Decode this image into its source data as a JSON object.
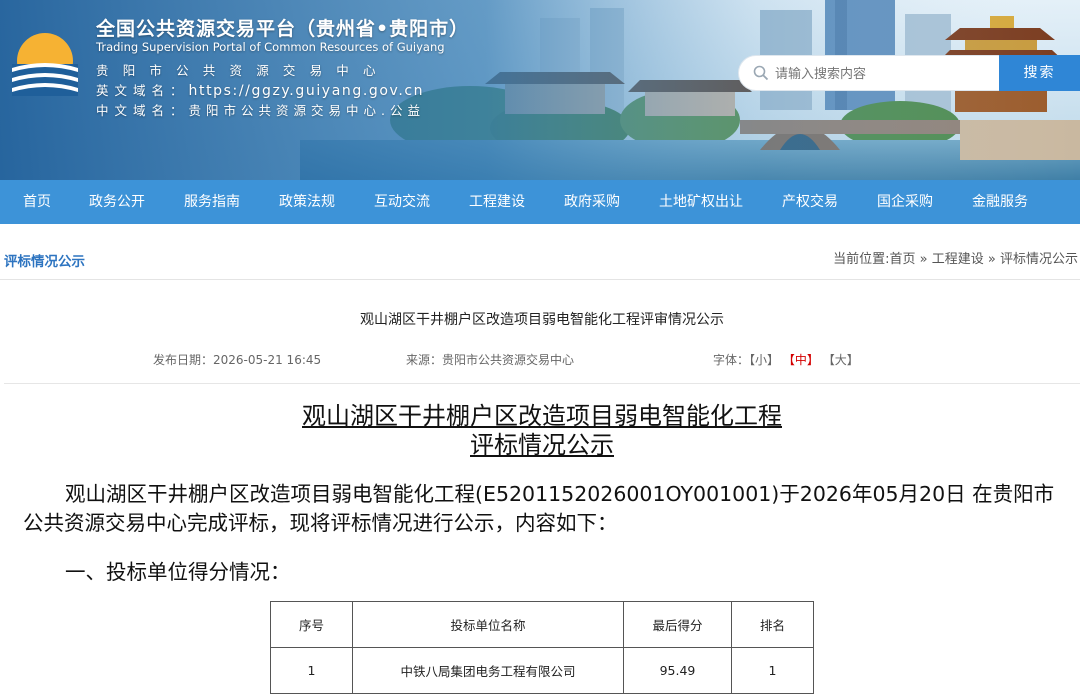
{
  "header": {
    "title": "全国公共资源交易平台（贵州省•贵阳市）",
    "title_en": "Trading Supervision Portal of Common Resources of Guiyang",
    "org_name": "贵阳市公共资源交易中心",
    "en_domain_label": "英文域名：",
    "en_domain": "https://ggzy.guiyang.gov.cn",
    "cn_domain_label": "中文域名：",
    "cn_domain": "贵阳市公共资源交易中心.公益",
    "search_placeholder": "请输入搜索内容",
    "search_button": "搜索",
    "colors": {
      "nav": "#3d93d8",
      "search_button": "#2f86d6"
    }
  },
  "nav": {
    "items": [
      "首页",
      "政务公开",
      "服务指南",
      "政策法规",
      "互动交流",
      "工程建设",
      "政府采购",
      "土地矿权出让",
      "产权交易",
      "国企采购",
      "金融服务"
    ]
  },
  "breadcrumb": {
    "section_title": "评标情况公示",
    "location": "当前位置:首页 » 工程建设 » 评标情况公示"
  },
  "article": {
    "title": "观山湖区干井棚户区改造项目弱电智能化工程评审情况公示",
    "publish_date": "发布日期：2026-05-21 16:45",
    "source": "来源：贵阳市公共资源交易中心",
    "font_label": "字体：",
    "font_small": "【小】",
    "font_medium": "【中】",
    "font_large": "【大】",
    "doc_title_line1": "观山湖区干井棚户区改造项目弱电智能化工程",
    "doc_title_line2": "评标情况公示",
    "intro": "观山湖区干井棚户区改造项目弱电智能化工程(E5201152026001OY001001)于2026年05月20日 在贵阳市公共资源交易中心完成评标，现将评标情况进行公示，内容如下：",
    "section_1": "一、投标单位得分情况："
  },
  "score_table": {
    "headers": [
      "序号",
      "投标单位名称",
      "最后得分",
      "排名"
    ],
    "rows": [
      [
        "1",
        "中铁八局集团电务工程有限公司",
        "95.49",
        "1"
      ]
    ]
  }
}
